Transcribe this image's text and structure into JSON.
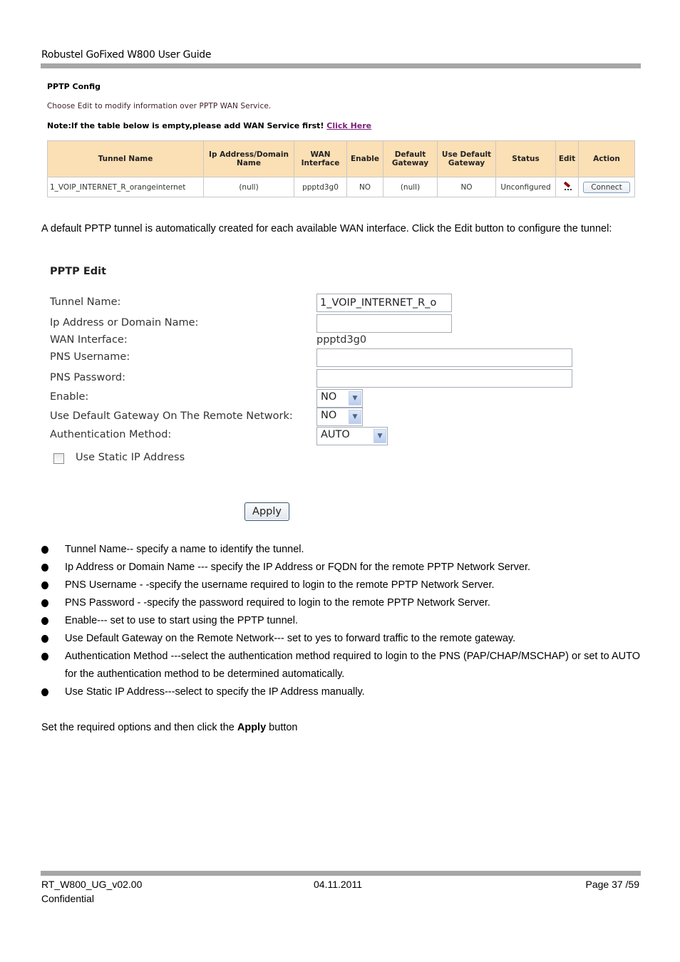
{
  "document": {
    "header_title": "Robustel GoFixed W800 User Guide",
    "footer": {
      "doc_id": "RT_W800_UG_v02.00",
      "classification": "Confidential",
      "date": "04.11.2011",
      "page": "Page 37 /59"
    }
  },
  "pptp_config": {
    "title": "PPTP Config",
    "description": "Choose Edit to modify information over PPTP WAN Service.",
    "note": "Note:If the table below is empty,please add WAN Service first!",
    "note_link": "Click Here",
    "table": {
      "columns": [
        "Tunnel Name",
        "Ip Address/Domain Name",
        "WAN Interface",
        "Enable",
        "Default Gateway",
        "Use Default Gateway",
        "Status",
        "Edit",
        "Action"
      ],
      "rows": [
        {
          "tunnel_name": "1_VOIP_INTERNET_R_orangeinternet",
          "ip_address": "(null)",
          "wan_interface": "ppptd3g0",
          "enable": "NO",
          "default_gateway": "(null)",
          "use_default_gateway": "NO",
          "status": "Unconfigured",
          "edit_icon": "pencil-icon",
          "action": "Connect"
        }
      ]
    }
  },
  "intro_text": "A default PPTP tunnel is automatically created for each available WAN interface. Click the Edit button to configure the tunnel:",
  "pptp_edit": {
    "title": "PPTP Edit",
    "fields": {
      "tunnel_name": {
        "label": "Tunnel Name:",
        "value": "1_VOIP_INTERNET_R_o"
      },
      "ip_address": {
        "label": "Ip Address or Domain Name:",
        "value": ""
      },
      "wan_interface": {
        "label": "WAN Interface:",
        "value": "ppptd3g0"
      },
      "pns_username": {
        "label": "PNS Username:",
        "value": ""
      },
      "pns_password": {
        "label": "PNS Password:",
        "value": ""
      },
      "enable": {
        "label": "Enable:",
        "value": "NO"
      },
      "use_default_gateway": {
        "label": "Use Default Gateway On The Remote Network:",
        "value": "NO"
      },
      "auth_method": {
        "label": "Authentication Method:",
        "value": "AUTO"
      },
      "static_ip": {
        "label": "Use Static IP Address",
        "checked": false
      }
    },
    "apply_label": "Apply"
  },
  "bullets": [
    "Tunnel Name-- specify a name to identify the tunnel.",
    "Ip Address or Domain Name --- specify the IP Address or FQDN for the remote PPTP Network Server.",
    "PNS Username - -specify the username required to login to the remote PPTP Network Server.",
    "PNS Password - -specify the password required to login to the remote PPTP Network Server.",
    "Enable--- set to use to start using the PPTP tunnel.",
    "Use Default Gateway on the Remote Network--- set to yes to forward traffic to the remote gateway.",
    "Authentication Method ---select the authentication method required to login to the PNS (PAP/CHAP/MSCHAP) or set to AUTO for the authentication method to be determined automatically.",
    "Use Static IP Address---select to specify the IP Address manually."
  ],
  "final_text": {
    "before": "Set the required options and then click the ",
    "bold": "Apply",
    "after": " button"
  },
  "colors": {
    "table_header_bg": "#fbdfb5",
    "link": "#7a1f7a",
    "rule": "#a6a6a6"
  }
}
